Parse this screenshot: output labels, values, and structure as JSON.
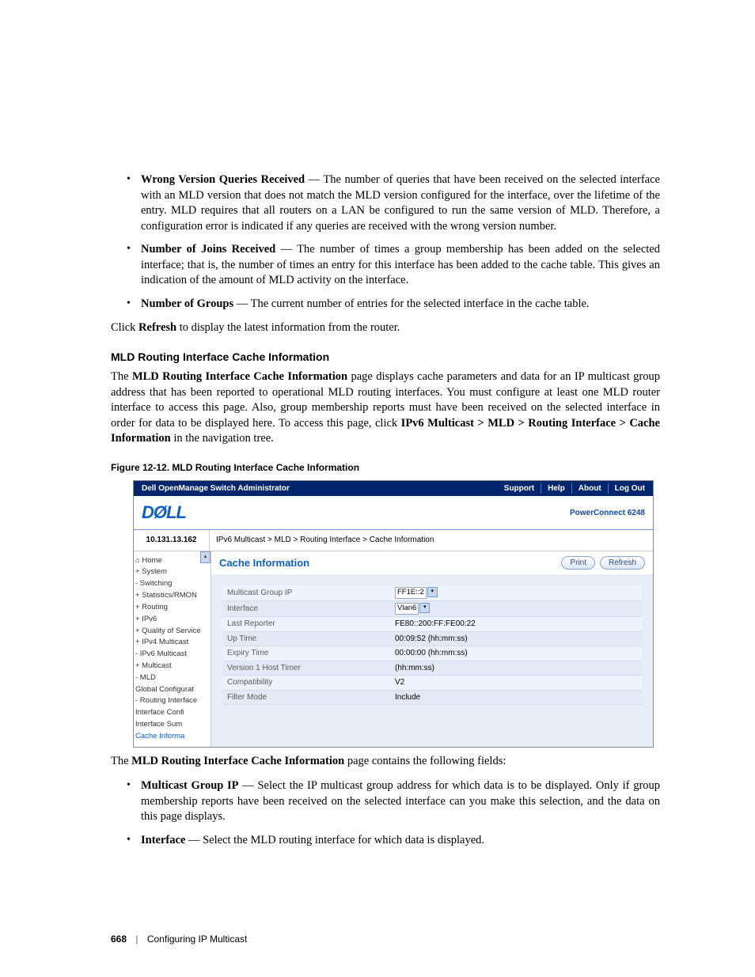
{
  "bullets1": [
    {
      "term": "Wrong Version Queries Received",
      "desc": "The number of queries that have been received on the selected interface with an MLD version that does not match the MLD version configured for the interface, over the lifetime of the entry. MLD requires that all routers on a LAN be configured to run the same version of MLD. Therefore, a configuration error is indicated if any queries are received with the wrong version number."
    },
    {
      "term": "Number of Joins Received",
      "desc": "The number of times a group membership has been added on the selected interface; that is, the number of times an entry for this interface has been added to the cache table. This gives an indication of the amount of MLD activity on the interface."
    },
    {
      "term": "Number of Groups",
      "desc": "The current number of entries for the selected interface in the cache table."
    }
  ],
  "refresh_click_pre": "Click ",
  "refresh_click_b": "Refresh",
  "refresh_click_post": " to display the latest information from the router.",
  "section_heading": "MLD Routing Interface Cache Information",
  "para1_pre": "The ",
  "para1_b": "MLD Routing Interface Cache Information",
  "para1_post": " page displays cache parameters and data for an IP multicast group address that has been reported to operational MLD routing interfaces. You must configure at least one MLD router interface to access this page. Also, group membership reports must have been received on the selected interface in order for data to be displayed here. To access this page, click ",
  "para1_nav": "IPv6 Multicast > MLD > Routing Interface > Cache Information",
  "para1_end": " in the navigation tree.",
  "figure_caption": "Figure 12-12.    MLD Routing Interface Cache Information",
  "screenshot": {
    "topbar_title": "Dell OpenManage Switch Administrator",
    "top_links": [
      "Support",
      "Help",
      "About",
      "Log Out"
    ],
    "logo": "DØLL",
    "model": "PowerConnect 6248",
    "ip": "10.131.13.162",
    "breadcrumbs": "IPv6 Multicast > MLD > Routing Interface > Cache Information",
    "page_title": "Cache Information",
    "buttons": {
      "print": "Print",
      "refresh": "Refresh"
    },
    "tree": [
      {
        "label": "Home",
        "indent": 0,
        "prefix": "⌂"
      },
      {
        "label": "System",
        "indent": 0,
        "prefix": "+"
      },
      {
        "label": "Switching",
        "indent": 0,
        "prefix": "-"
      },
      {
        "label": "Statistics/RMON",
        "indent": 0,
        "prefix": "+"
      },
      {
        "label": "Routing",
        "indent": 0,
        "prefix": "+"
      },
      {
        "label": "IPv6",
        "indent": 0,
        "prefix": "+"
      },
      {
        "label": "Quality of Service",
        "indent": 0,
        "prefix": "+"
      },
      {
        "label": "IPv4 Multicast",
        "indent": 0,
        "prefix": "+"
      },
      {
        "label": "IPv6 Multicast",
        "indent": 0,
        "prefix": "-"
      },
      {
        "label": "Multicast",
        "indent": 1,
        "prefix": "+"
      },
      {
        "label": "MLD",
        "indent": 1,
        "prefix": "-"
      },
      {
        "label": "Global Configurat",
        "indent": 2,
        "prefix": ""
      },
      {
        "label": "Routing Interface",
        "indent": 2,
        "prefix": "-"
      },
      {
        "label": "Interface Confi",
        "indent": 3,
        "prefix": ""
      },
      {
        "label": "Interface Sum",
        "indent": 3,
        "prefix": ""
      },
      {
        "label": "Cache Informa",
        "indent": 3,
        "prefix": "",
        "sel": true
      }
    ],
    "rows": [
      {
        "label": "Multicast Group IP",
        "value": "FF1E::2",
        "select": true
      },
      {
        "label": "Interface",
        "value": "Vlan6",
        "select": true
      },
      {
        "label": "Last Reporter",
        "value": "FE80::200:FF:FE00:22"
      },
      {
        "label": "Up Time",
        "value": "00:09:52  (hh:mm:ss)"
      },
      {
        "label": "Expiry Time",
        "value": "00:00:00  (hh:mm:ss)"
      },
      {
        "label": "Version 1 Host Timer",
        "value": "(hh:mm:ss)"
      },
      {
        "label": "Compatibility",
        "value": "V2"
      },
      {
        "label": "Filter Mode",
        "value": "Include"
      }
    ]
  },
  "para2_pre": "The ",
  "para2_b": "MLD Routing Interface Cache Information",
  "para2_post": " page contains the following fields:",
  "bullets2": [
    {
      "term": "Multicast Group IP",
      "desc": "Select the IP multicast group address for which data is to be displayed. Only if group membership reports have been received on the selected interface can you make this selection, and the data on this page displays."
    },
    {
      "term": "Interface",
      "desc": "Select the MLD routing interface for which data is displayed."
    }
  ],
  "footer": {
    "page": "668",
    "section": "Configuring IP Multicast"
  }
}
